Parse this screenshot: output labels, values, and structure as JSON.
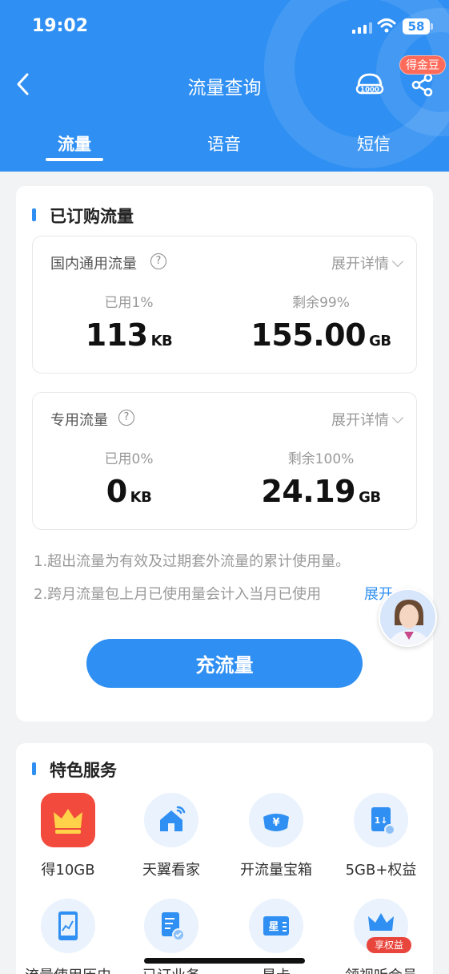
{
  "status_bar": {
    "time": "19:02",
    "battery": "58"
  },
  "nav": {
    "title": "流量查询",
    "gold_badge": "得金豆"
  },
  "tabs": [
    {
      "label": "流量",
      "active": true
    },
    {
      "label": "语音",
      "active": false
    },
    {
      "label": "短信",
      "active": false
    }
  ],
  "subscribed": {
    "section_title": "已订购流量",
    "domestic": {
      "title": "国内通用流量",
      "help": "?",
      "expand_label": "展开详情",
      "used_label": "已用1%",
      "used_value": "113",
      "used_unit": "KB",
      "remaining_label": "剩余99%",
      "remaining_value": "155.00",
      "remaining_unit": "GB",
      "used_fraction": 0.01
    },
    "dedicated": {
      "title": "专用流量",
      "help": "?",
      "expand_label": "展开详情",
      "used_label": "已用0%",
      "used_value": "0",
      "used_unit": "KB",
      "remaining_label": "剩余100%",
      "remaining_value": "24.19",
      "remaining_unit": "GB",
      "used_fraction": 0.0
    },
    "note1": "1.超出流量为有效及过期套外流量的累计使用量。",
    "note2": "2.跨月流量包上月已使用量会计入当月已使用",
    "note_expand": "展开",
    "recharge_button": "充流量"
  },
  "services": {
    "section_title": "特色服务",
    "items": [
      {
        "label": "得10GB",
        "icon": "crown-icon"
      },
      {
        "label": "天翼看家",
        "icon": "home-wifi-icon"
      },
      {
        "label": "开流量宝箱",
        "icon": "treasure-box-icon"
      },
      {
        "label": "5GB+权益",
        "icon": "sim-card-icon"
      },
      {
        "label": "流量使用历史",
        "icon": "usage-chart-icon"
      },
      {
        "label": "已订业务",
        "icon": "order-doc-icon"
      },
      {
        "label": "星卡",
        "icon": "star-card-icon"
      },
      {
        "label": "领视听会员",
        "icon": "vip-crown-icon",
        "badge": "享权益"
      }
    ]
  },
  "colors": {
    "brand": "#2f8ff2",
    "accent_red": "#f24a3c"
  }
}
